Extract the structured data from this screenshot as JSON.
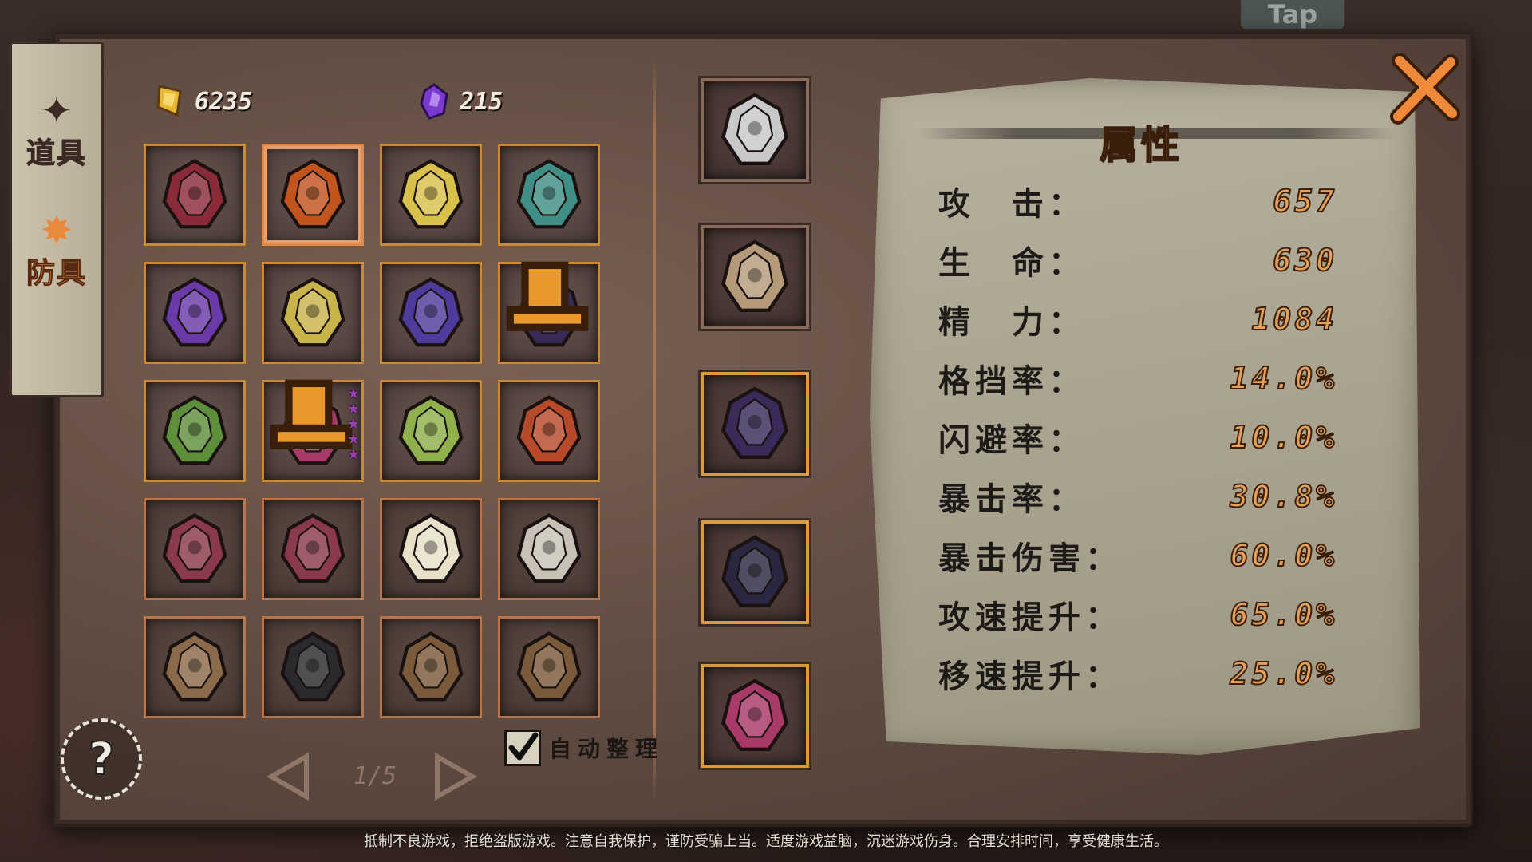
{
  "top_sign": "Tap",
  "tabs": [
    {
      "label": "道具",
      "icon": "item-tab-icon",
      "active": false
    },
    {
      "label": "防具",
      "icon": "armor-tab-icon",
      "active": true
    }
  ],
  "currency": {
    "gold": {
      "value": "6235",
      "icon": "gold-crystal-icon"
    },
    "gem": {
      "value": "215",
      "icon": "purple-gem-icon"
    }
  },
  "inventory": {
    "page": "1/5",
    "auto_sort_label": "自动整理",
    "auto_sort_checked": true,
    "items": [
      {
        "name": "demon-knight-armor",
        "color": "#8a2b3a",
        "frame": "gold",
        "selected": false
      },
      {
        "name": "flame-golem-armor",
        "color": "#c2541e",
        "frame": "gold",
        "selected": true
      },
      {
        "name": "winged-golden-armor",
        "color": "#d8c04a",
        "frame": "gold",
        "selected": false
      },
      {
        "name": "teal-beast-armor",
        "color": "#3f8f86",
        "frame": "gold",
        "selected": false
      },
      {
        "name": "void-shard-armor",
        "color": "#6a3aa8",
        "frame": "gold",
        "selected": false
      },
      {
        "name": "golden-orb-armor",
        "color": "#c9b44a",
        "frame": "gold",
        "selected": false
      },
      {
        "name": "shadow-spire-armor",
        "color": "#4f3b9c",
        "frame": "gold",
        "selected": false
      },
      {
        "name": "horned-shadow-mask",
        "color": "#3a2a5a",
        "frame": "gold",
        "selected": false,
        "hat": true
      },
      {
        "name": "forest-spirit-armor",
        "color": "#5e8f3a",
        "frame": "gold",
        "selected": false
      },
      {
        "name": "crimson-boots",
        "color": "#a83a6a",
        "frame": "gold",
        "selected": false,
        "hat": true,
        "stars": 5
      },
      {
        "name": "jade-crystal-armor",
        "color": "#8fb04a",
        "frame": "gold",
        "selected": false
      },
      {
        "name": "lava-dragon-armor",
        "color": "#b84a2a",
        "frame": "gold",
        "selected": false
      },
      {
        "name": "crimson-vest",
        "color": "#8a3a4a",
        "frame": "plain",
        "selected": false
      },
      {
        "name": "crimson-vest",
        "color": "#8a3a4a",
        "frame": "plain",
        "selected": false
      },
      {
        "name": "white-holy-coat",
        "color": "#e8e0c8",
        "frame": "plain",
        "selected": false
      },
      {
        "name": "bandage-wrap",
        "color": "#c8c2b6",
        "frame": "plain",
        "selected": false
      },
      {
        "name": "spiked-gauntlet",
        "color": "#8a6a4a",
        "frame": "plain",
        "selected": false
      },
      {
        "name": "black-plate-shirt",
        "color": "#2a2a2e",
        "frame": "plain",
        "selected": false
      },
      {
        "name": "fur-shoulder-pad",
        "color": "#7a5a3a",
        "frame": "plain",
        "selected": false
      },
      {
        "name": "fur-shoulder-pad",
        "color": "#7a5a3a",
        "frame": "plain",
        "selected": false
      }
    ]
  },
  "equipped": [
    {
      "name": "curved-dagger",
      "color": "#c8c8c8",
      "frame": "plain"
    },
    {
      "name": "wooden-shield",
      "color": "#b59a7a",
      "frame": "plain"
    },
    {
      "name": "horned-shadow-mask",
      "color": "#3a2a5a",
      "frame": "gold"
    },
    {
      "name": "dark-hood-jacket",
      "color": "#2a2840",
      "frame": "gold"
    },
    {
      "name": "crimson-boots",
      "color": "#a83a6a",
      "frame": "gold"
    }
  ],
  "stats": {
    "title": "属性",
    "rows": [
      {
        "label": "攻　击：",
        "value": "657"
      },
      {
        "label": "生　命：",
        "value": "630"
      },
      {
        "label": "精　力：",
        "value": "1084"
      },
      {
        "label": "格挡率：",
        "value": "14.0%"
      },
      {
        "label": "闪避率：",
        "value": "10.0%"
      },
      {
        "label": "暴击率：",
        "value": "30.8%"
      },
      {
        "label": "暴击伤害：",
        "value": "60.0%"
      },
      {
        "label": "攻速提升：",
        "value": "65.0%"
      },
      {
        "label": "移速提升：",
        "value": "25.0%"
      }
    ]
  },
  "footer_notice": "抵制不良游戏，拒绝盗版游戏。注意自我保护，谨防受骗上当。适度游戏益脑，沉迷游戏伤身。合理安排时间，享受健康生活。",
  "colors": {
    "accent": "#e88a3c",
    "frame_gold": "#c88a3a",
    "stat_value": "#e3a05a"
  }
}
